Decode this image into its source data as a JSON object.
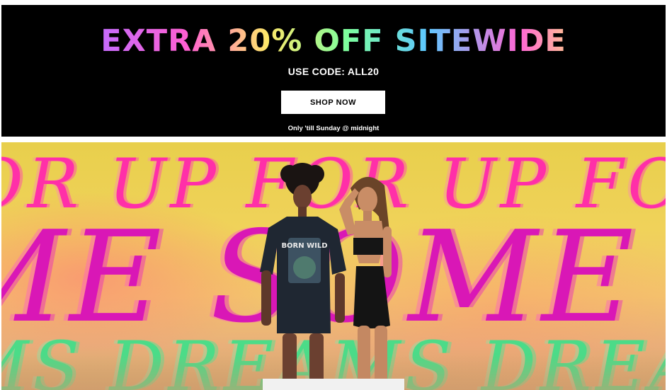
{
  "promo": {
    "headline": "EXTRA 20% OFF SITEWIDE",
    "code_text": "USE CODE: ALL20",
    "button_label": "SHOP NOW",
    "note": "Only 'till Sunday @ midnight"
  },
  "hero": {
    "top_text": "OR UP FOR UP FOR UP FOR",
    "middle_text": "ME SOME SOME SOME",
    "bottom_text": "MS DREAMS DREAMS DR",
    "shirt_text": "BORN WILD"
  },
  "colors": {
    "promo_background": "#000000",
    "button_background": "#ffffff",
    "hero_yellow": "#f0d25a",
    "script_pink": "#ff2fa8",
    "script_magenta": "#d917b6",
    "script_green": "#3be18a"
  }
}
